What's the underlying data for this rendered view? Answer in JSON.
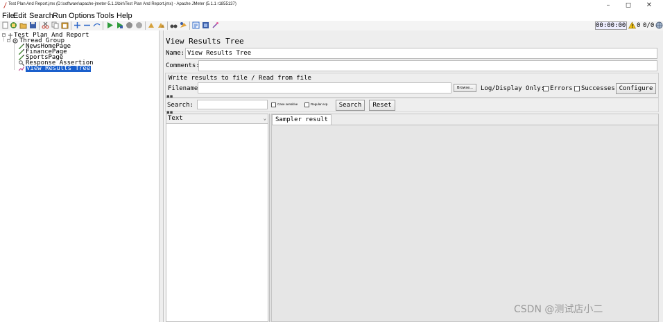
{
  "window": {
    "title": "Test Plan And Report.jmx (D:\\software\\apache-jmeter-5.1.1\\bin\\Test Plan And Report.jmx) - Apache JMeter (5.1.1 r1855137)",
    "minimize": "–",
    "maximize": "◻",
    "close": "✕"
  },
  "menu": [
    "File",
    "Edit",
    "Search",
    "Run",
    "Options",
    "Tools",
    "Help"
  ],
  "toolbar": {
    "timer": "00:00:00",
    "warning_count": "0",
    "threads": "0/0",
    "accent": "#2a66c9"
  },
  "tree": {
    "root": "Test Plan And Report",
    "thread_group": "Thread Group",
    "children": [
      "NewsHomePage",
      "FinancePage",
      "SportsPage",
      "Response Assertion",
      "View Results Tree"
    ],
    "selected_color": "#1a5fcc"
  },
  "panel": {
    "title": "View Results Tree",
    "name_label": "Name:",
    "name_value": "View Results Tree",
    "comments_label": "Comments:",
    "comments_value": "",
    "write_results": "Write results to file / Read from file",
    "filename_label": "Filename",
    "filename_value": "",
    "browse": "Browse...",
    "log_display": "Log/Display Only:",
    "errors_label": "Errors",
    "successes_label": "Successes",
    "configure": "Configure",
    "search_label": "Search:",
    "search_value": "",
    "case_sensitive": "Case sensitive",
    "regular_exp": "Regular exp.",
    "search_button": "Search",
    "reset_button": "Reset",
    "renderer": "Text",
    "tab_sampler_result": "Sampler result"
  },
  "watermark": "CSDN @测试店小二"
}
